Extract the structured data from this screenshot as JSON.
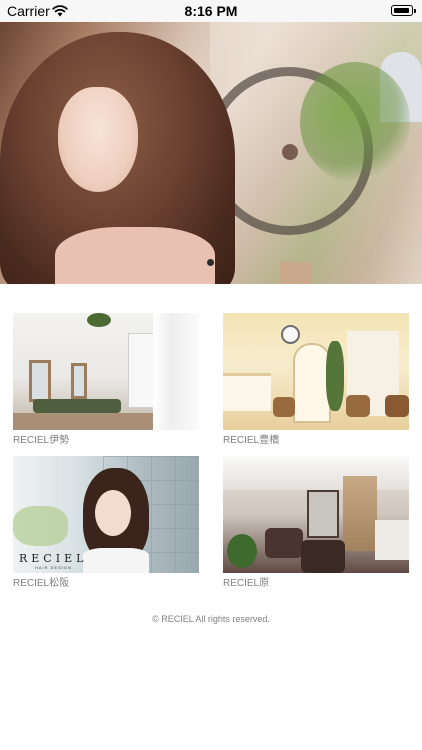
{
  "status_bar": {
    "carrier": "Carrier",
    "time": "8:16 PM",
    "icons": [
      "wifi-icon",
      "battery-icon"
    ],
    "battery_level": 0.8
  },
  "hero": {
    "slide_count": 1,
    "active_slide": 1
  },
  "salons": [
    {
      "name": "RECIEL伊勢"
    },
    {
      "name": "RECIEL豊橋"
    },
    {
      "name": "RECIEL松阪",
      "photo_logo": "RECIEL",
      "photo_logo_sub": "HAIR DESIGN"
    },
    {
      "name": "RECIEL原"
    }
  ],
  "footer": {
    "copyright": "© RECIEL All rights reserved."
  },
  "colors": {
    "background": "#ffffff",
    "status_bar": "#f7f7f7",
    "label_text": "#808080",
    "pager_dot": "#2a2a2a"
  }
}
